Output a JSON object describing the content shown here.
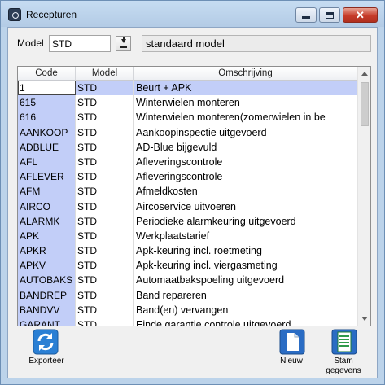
{
  "window": {
    "title": "Recepturen"
  },
  "filter": {
    "model_label": "Model",
    "model_value": "STD",
    "model_description": "standaard model"
  },
  "grid": {
    "columns": [
      "Code",
      "Model",
      "Omschrijving"
    ],
    "rows": [
      {
        "code": "1",
        "model": "STD",
        "omschrijving": "Beurt + APK",
        "selected": true
      },
      {
        "code": "615",
        "model": "STD",
        "omschrijving": "Winterwielen monteren"
      },
      {
        "code": "616",
        "model": "STD",
        "omschrijving": "Winterwielen monteren(zomerwielen in be"
      },
      {
        "code": "AANKOOP",
        "model": "STD",
        "omschrijving": "Aankoopinspectie uitgevoerd"
      },
      {
        "code": "ADBLUE",
        "model": "STD",
        "omschrijving": "AD-Blue bijgevuld"
      },
      {
        "code": "AFL",
        "model": "STD",
        "omschrijving": "Afleveringscontrole"
      },
      {
        "code": "AFLEVER",
        "model": "STD",
        "omschrijving": "Afleveringscontrole"
      },
      {
        "code": "AFM",
        "model": "STD",
        "omschrijving": "Afmeldkosten"
      },
      {
        "code": "AIRCO",
        "model": "STD",
        "omschrijving": "Aircoservice uitvoeren"
      },
      {
        "code": "ALARMK",
        "model": "STD",
        "omschrijving": "Periodieke alarmkeuring  uitgevoerd"
      },
      {
        "code": "APK",
        "model": "STD",
        "omschrijving": "Werkplaatstarief"
      },
      {
        "code": "APKR",
        "model": "STD",
        "omschrijving": "Apk-keuring incl. roetmeting"
      },
      {
        "code": "APKV",
        "model": "STD",
        "omschrijving": "Apk-keuring incl. viergasmeting"
      },
      {
        "code": "AUTOBAKS",
        "model": "STD",
        "omschrijving": "Automaatbakspoeling uitgevoerd"
      },
      {
        "code": "BANDREP",
        "model": "STD",
        "omschrijving": "Band repareren"
      },
      {
        "code": "BANDVV",
        "model": "STD",
        "omschrijving": "Band(en) vervangen"
      },
      {
        "code": "GARANT",
        "model": "STD",
        "omschrijving": "Einde garantie controle uitgevoerd"
      }
    ]
  },
  "toolbar": {
    "export_label": "Exporteer",
    "new_label": "Nieuw",
    "master_label": "Stam\ngegevens"
  },
  "colors": {
    "code_column_bg": "#c2cef8",
    "title_bar": "#bcd3ea",
    "close_button": "#c63b2a"
  },
  "icons": {
    "app": "app-icon",
    "export": "refresh-arrows-icon",
    "new": "new-document-icon",
    "master": "document-list-icon"
  }
}
